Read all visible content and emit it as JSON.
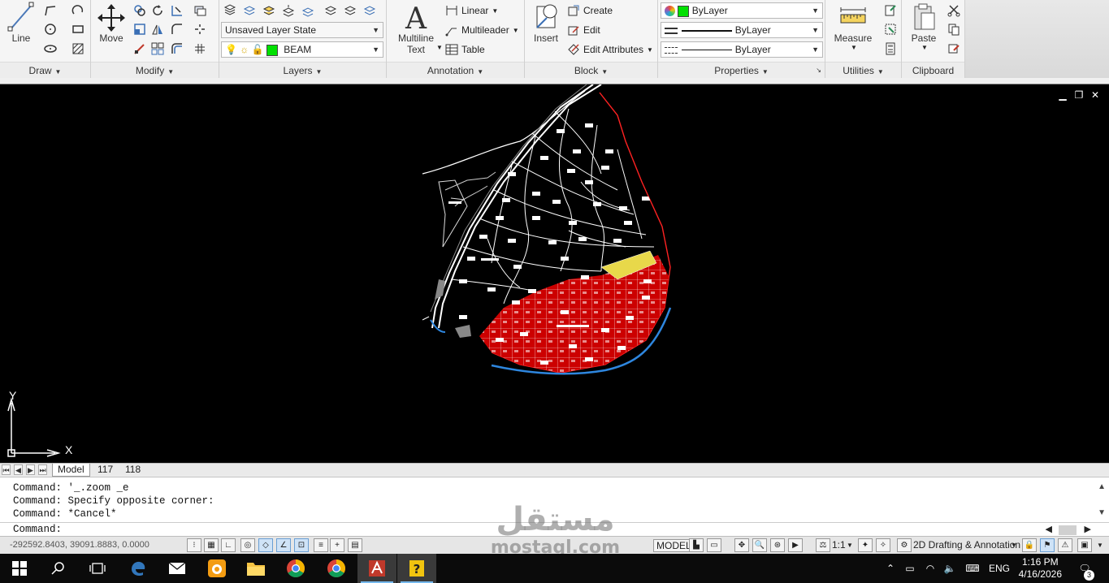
{
  "ribbon": {
    "draw": {
      "title": "Draw",
      "line_label": "Line"
    },
    "modify": {
      "title": "Modify",
      "move_label": "Move"
    },
    "layers": {
      "title": "Layers",
      "layer_state": "Unsaved Layer State",
      "current_layer": "BEAM",
      "layer_color": "#00e000"
    },
    "annotation": {
      "title": "Annotation",
      "multiline_text_label_1": "Multiline",
      "multiline_text_label_2": "Text",
      "linear_label": "Linear",
      "multileader_label": "Multileader",
      "table_label": "Table"
    },
    "block": {
      "title": "Block",
      "insert_label": "Insert",
      "create_label": "Create",
      "edit_label": "Edit",
      "edit_attributes_label": "Edit Attributes"
    },
    "properties": {
      "title": "Properties",
      "color_value": "ByLayer",
      "linetype_value": "ByLayer",
      "lineweight_value": "ByLayer",
      "color_swatch": "#00e000"
    },
    "utilities": {
      "title": "Utilities",
      "measure_label": "Measure"
    },
    "clipboard": {
      "title": "Clipboard",
      "paste_label": "Paste"
    }
  },
  "viewport": {
    "ucs_y": "Y",
    "ucs_x": "X",
    "background": "#000000"
  },
  "layout_tabs": [
    {
      "label": "Model",
      "active": true
    },
    {
      "label": "117",
      "active": false
    },
    {
      "label": "118",
      "active": false
    }
  ],
  "command": {
    "history": [
      "Command: '_.zoom _e",
      "Command: Specify opposite corner:",
      "Command: *Cancel*"
    ],
    "prompt": "Command:"
  },
  "status_bar": {
    "coordinates": "-292592.8403, 39091.8883, 0.0000",
    "space": "MODEL",
    "scale": "1:1",
    "workspace": "2D Drafting & Annotation"
  },
  "watermark": {
    "arabic": "مستقل",
    "latin": "mostaql.com"
  },
  "taskbar": {
    "language": "ENG",
    "time": "1:16 PM",
    "date": "4/16/2026",
    "notification_count": "3"
  }
}
